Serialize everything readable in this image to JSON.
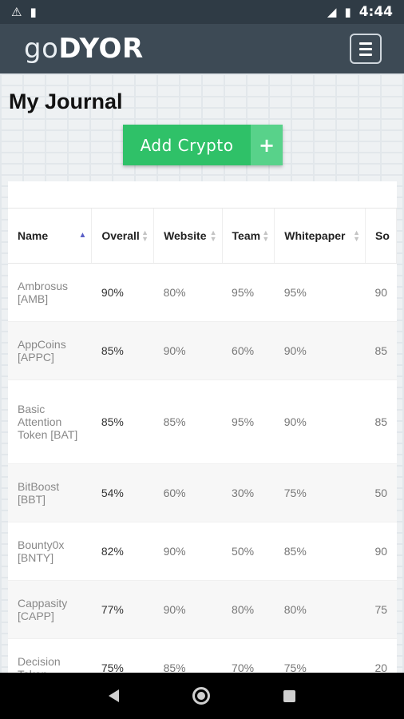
{
  "status_bar": {
    "time": "4:44",
    "icons": [
      "warning-icon",
      "sd-card-icon",
      "lte-signal-icon",
      "battery-icon"
    ]
  },
  "app_bar": {
    "logo_light": "go",
    "logo_bold": "DYOR",
    "menu_icon": "hamburger-icon"
  },
  "page": {
    "title": "My Journal",
    "add_button_label": "Add Crypto",
    "add_button_icon": "+"
  },
  "table": {
    "headers": [
      "Name",
      "Overall",
      "Website",
      "Team",
      "Whitepaper",
      "So"
    ],
    "sorted_column": "Name",
    "sort_direction": "ascending",
    "rows": [
      {
        "name": "Ambrosus [AMB]",
        "overall": "90%",
        "website": "80%",
        "team": "95%",
        "whitepaper": "95%",
        "so": "90"
      },
      {
        "name": "AppCoins [APPC]",
        "overall": "85%",
        "website": "90%",
        "team": "60%",
        "whitepaper": "90%",
        "so": "85"
      },
      {
        "name": "Basic Attention Token [BAT]",
        "overall": "85%",
        "website": "85%",
        "team": "95%",
        "whitepaper": "90%",
        "so": "85"
      },
      {
        "name": "BitBoost [BBT]",
        "overall": "54%",
        "website": "60%",
        "team": "30%",
        "whitepaper": "75%",
        "so": "50"
      },
      {
        "name": "Bounty0x [BNTY]",
        "overall": "82%",
        "website": "90%",
        "team": "50%",
        "whitepaper": "85%",
        "so": "90"
      },
      {
        "name": "Cappasity [CAPP]",
        "overall": "77%",
        "website": "90%",
        "team": "80%",
        "whitepaper": "80%",
        "so": "75"
      },
      {
        "name": "Decision Token",
        "overall": "75%",
        "website": "85%",
        "team": "70%",
        "whitepaper": "75%",
        "so": "20"
      }
    ]
  },
  "colors": {
    "status_bar_bg": "#2f3b45",
    "app_bar_bg": "#3d4a55",
    "accent_green": "#2fc168",
    "sort_active": "#5b5fc7"
  }
}
